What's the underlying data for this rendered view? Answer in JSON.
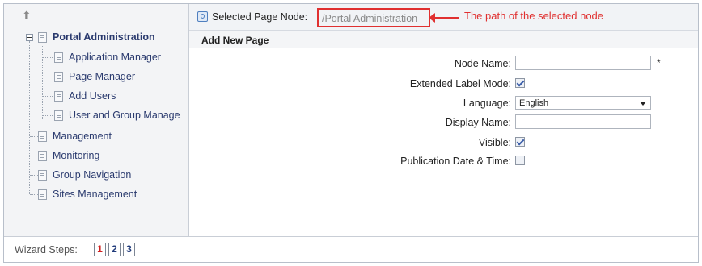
{
  "tree": {
    "root": "Portal Administration",
    "children": [
      "Application Manager",
      "Page Manager",
      "Add Users",
      "User and Group Manage"
    ],
    "siblings": [
      "Management",
      "Monitoring",
      "Group Navigation",
      "Sites Management"
    ],
    "up_icon": "up-arrow-icon"
  },
  "topbar": {
    "label": "Selected Page Node:",
    "path": "/Portal Administration",
    "callout": "The path of the selected node"
  },
  "form": {
    "section_title": "Add New Page",
    "node_name_label": "Node Name:",
    "node_name_value": "",
    "required_mark": "*",
    "extended_label": "Extended Label Mode:",
    "extended_checked": true,
    "language_label": "Language:",
    "language_value": "English",
    "display_name_label": "Display Name:",
    "display_name_value": "",
    "visible_label": "Visible:",
    "visible_checked": true,
    "publication_label": "Publication Date & Time:",
    "publication_checked": false
  },
  "wizard": {
    "label": "Wizard Steps:",
    "steps": [
      "1",
      "2",
      "3"
    ],
    "current": "1"
  },
  "colors": {
    "highlight": "#e03030",
    "link": "#2a3a6e"
  }
}
